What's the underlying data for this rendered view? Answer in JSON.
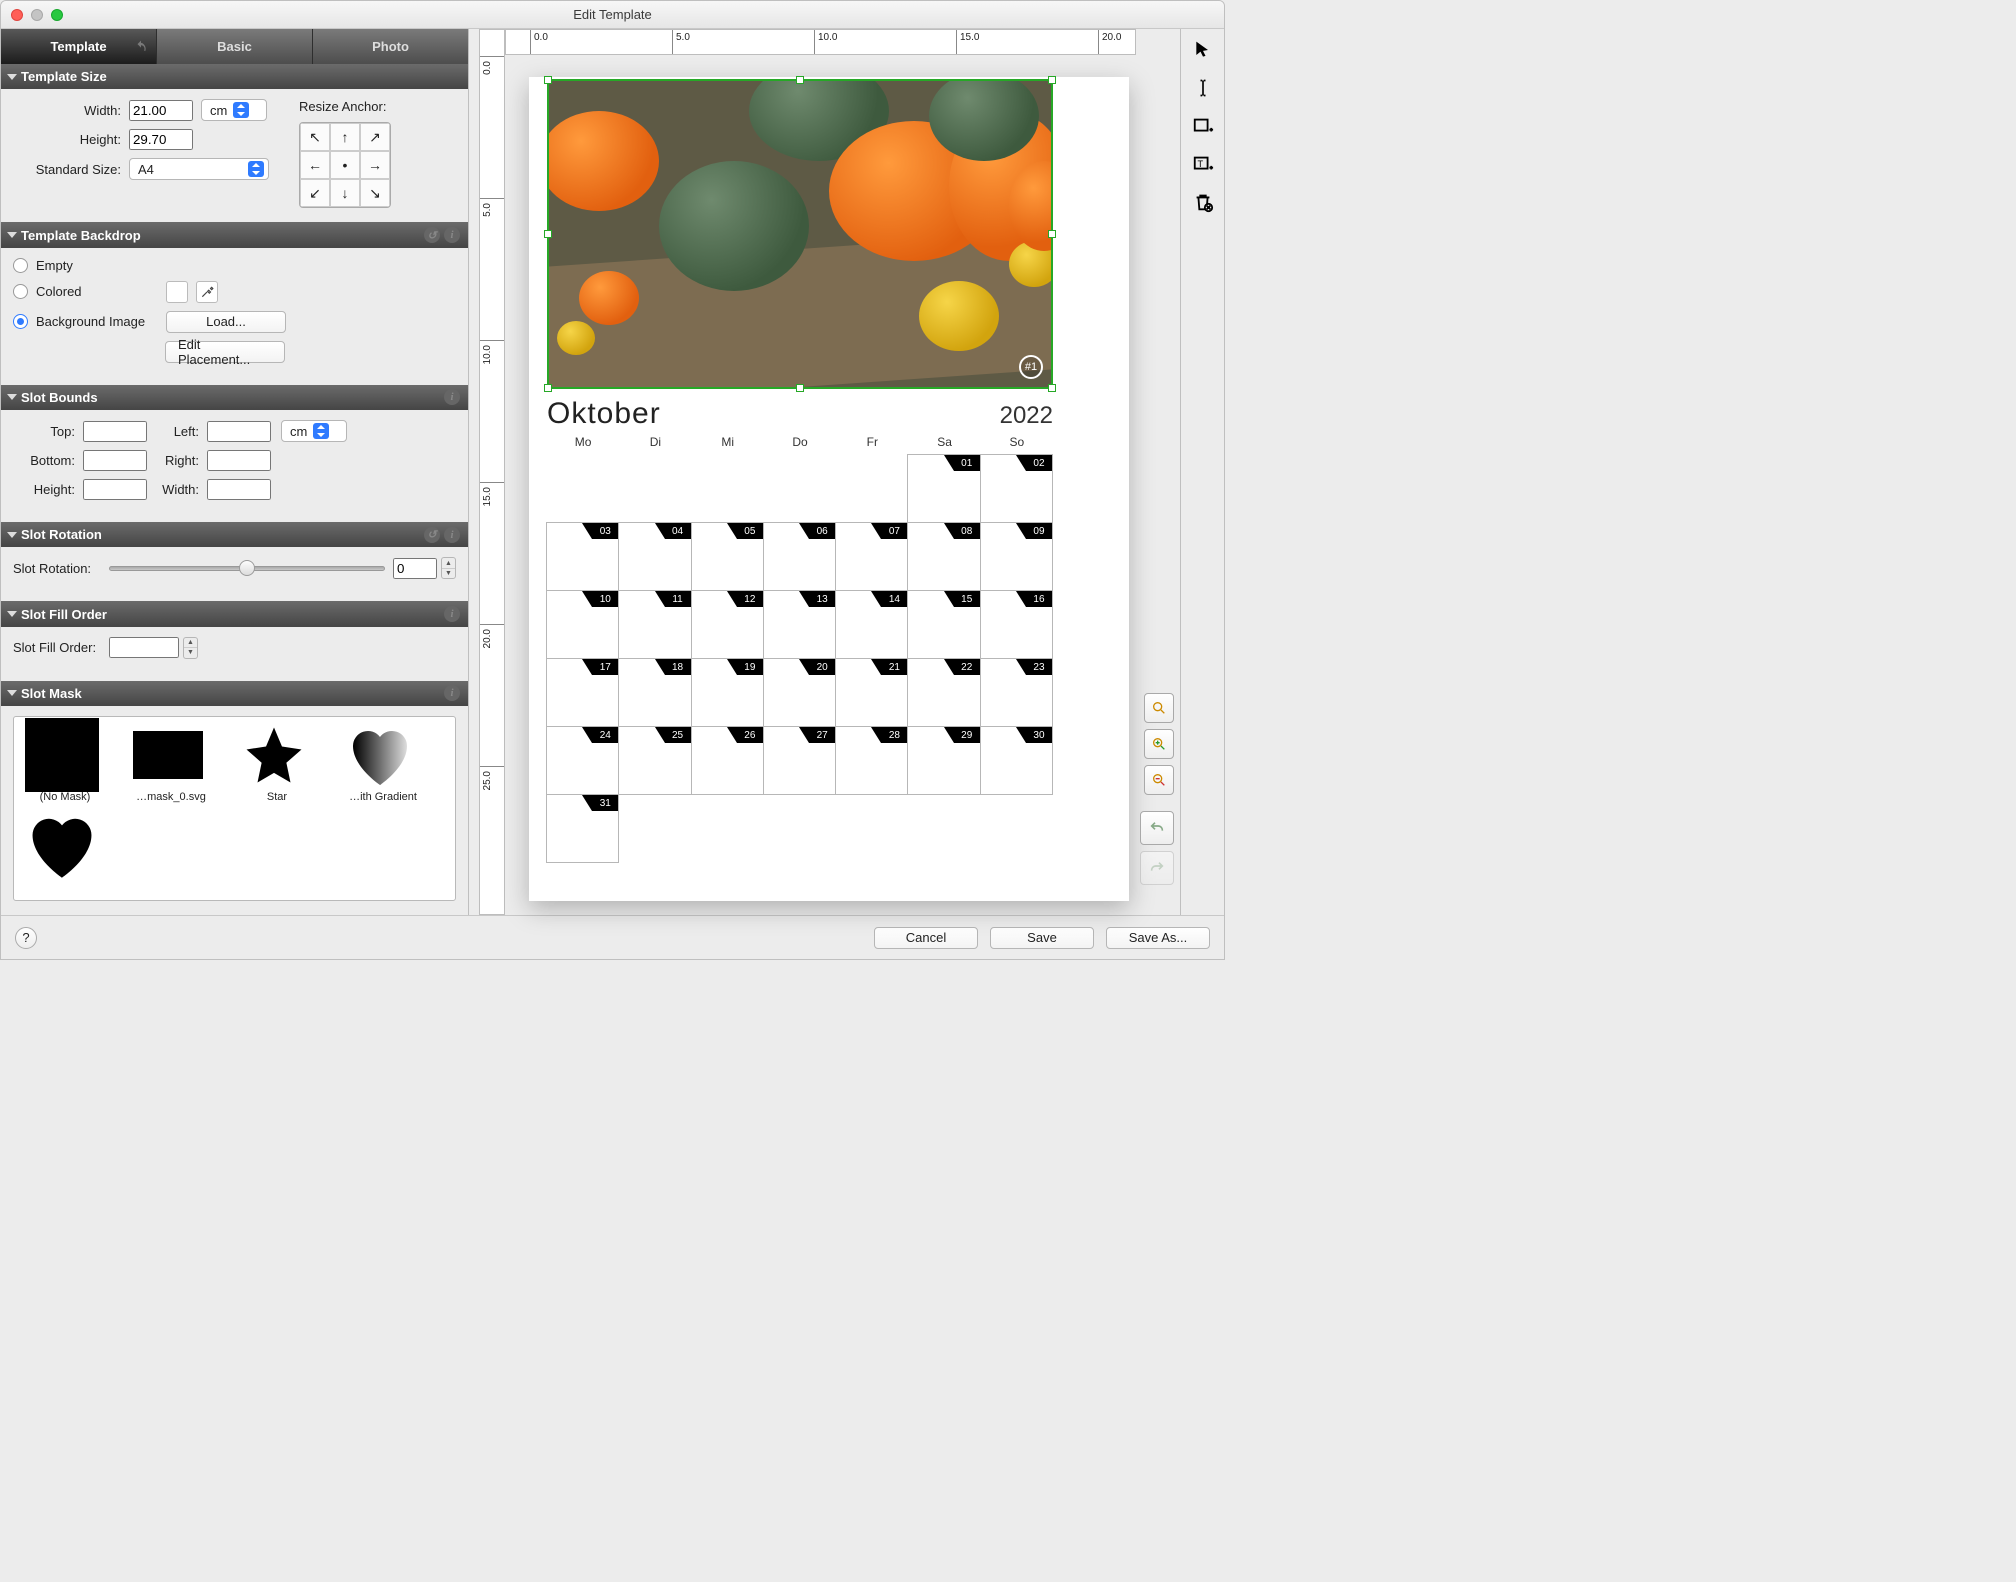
{
  "window_title": "Edit Template",
  "tabs": {
    "template": "Template",
    "basic": "Basic",
    "photo": "Photo"
  },
  "sections": {
    "size": "Template Size",
    "backdrop": "Template Backdrop",
    "bounds": "Slot Bounds",
    "rotation": "Slot Rotation",
    "fillorder": "Slot Fill Order",
    "mask": "Slot Mask"
  },
  "size": {
    "width_label": "Width:",
    "width": "21.00",
    "height_label": "Height:",
    "height": "29.70",
    "unit": "cm",
    "std_label": "Standard Size:",
    "std": "A4",
    "anchor_label": "Resize Anchor:"
  },
  "backdrop": {
    "empty": "Empty",
    "colored": "Colored",
    "bgimg": "Background Image",
    "load": "Load...",
    "edit": "Edit Placement..."
  },
  "bounds": {
    "top": "Top:",
    "left": "Left:",
    "bottom": "Bottom:",
    "right": "Right:",
    "height": "Height:",
    "width": "Width:",
    "unit": "cm"
  },
  "rotation": {
    "label": "Slot Rotation:",
    "value": "0"
  },
  "fillorder": {
    "label": "Slot Fill Order:",
    "value": ""
  },
  "masks": {
    "m0": "(No Mask)",
    "m1": "…mask_0.svg",
    "m2": "Star",
    "m3": "…ith Gradient"
  },
  "ruler": {
    "h": [
      "0.0",
      "5.0",
      "10.0",
      "15.0",
      "20.0"
    ],
    "v": [
      "0.0",
      "5.0",
      "10.0",
      "15.0",
      "20.0",
      "25.0"
    ]
  },
  "calendar": {
    "month": "Oktober",
    "year": "2022",
    "dows": [
      "Mo",
      "Di",
      "Mi",
      "Do",
      "Fr",
      "Sa",
      "So"
    ],
    "slot_badge": "#1",
    "grid": [
      [
        "",
        "",
        "",
        "",
        "",
        "01",
        "02"
      ],
      [
        "03",
        "04",
        "05",
        "06",
        "07",
        "08",
        "09"
      ],
      [
        "10",
        "11",
        "12",
        "13",
        "14",
        "15",
        "16"
      ],
      [
        "17",
        "18",
        "19",
        "20",
        "21",
        "22",
        "23"
      ],
      [
        "24",
        "25",
        "26",
        "27",
        "28",
        "29",
        "30"
      ],
      [
        "31",
        "",
        "",
        "",
        "",
        "",
        ""
      ]
    ]
  },
  "footer": {
    "cancel": "Cancel",
    "save": "Save",
    "saveas": "Save As...",
    "help": "?"
  }
}
